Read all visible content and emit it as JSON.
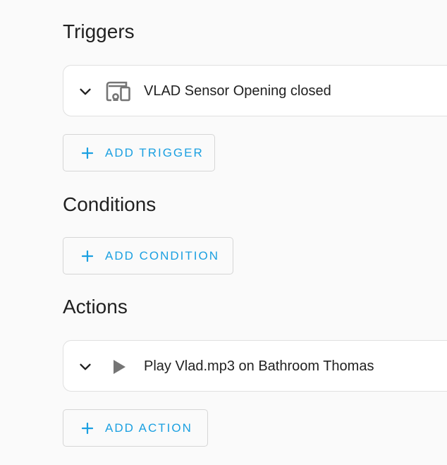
{
  "triggers": {
    "heading": "Triggers",
    "items": [
      {
        "label": "VLAD Sensor Opening closed",
        "icon": "device-icon"
      }
    ],
    "add_label": "ADD TRIGGER"
  },
  "conditions": {
    "heading": "Conditions",
    "add_label": "ADD CONDITION"
  },
  "actions": {
    "heading": "Actions",
    "items": [
      {
        "label": "Play Vlad.mp3 on Bathroom Thomas",
        "icon": "play-icon"
      }
    ],
    "add_label": "ADD ACTION"
  },
  "colors": {
    "accent": "#1ba0e1",
    "background": "#fafafa",
    "card": "#ffffff",
    "text": "#212121",
    "icon": "#757575"
  }
}
